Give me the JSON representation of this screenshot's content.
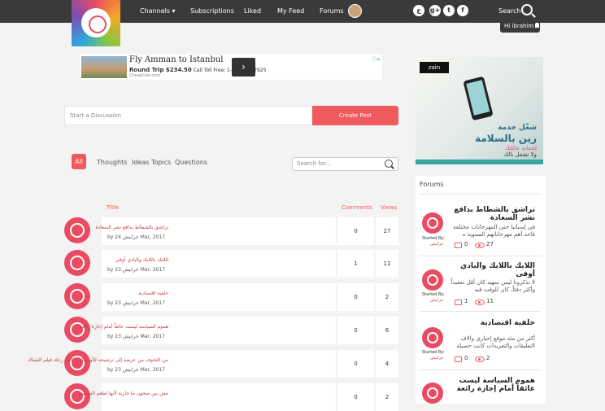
{
  "header": {
    "nav": [
      "Channels ▾",
      "Subscriptions",
      "Liked",
      "My Feed",
      "Forums"
    ],
    "social": [
      "ع",
      "g+",
      "t",
      "f"
    ],
    "search_label": "Search",
    "greeting": "Hi ibrahim"
  },
  "ad": {
    "title": "Fly Amman to Istanbul",
    "price_prefix": "Round Trip $234.50",
    "price_suffix": "Call Toll Free: 1-888-516-7925",
    "source": "CheapOair.com",
    "arrow": "›",
    "close": "ⓘ✕"
  },
  "composer": {
    "placeholder": "Start a Discussion",
    "create_label": "Create Post"
  },
  "filters": [
    "All",
    "Thoughts",
    "Ideas Topics",
    "Questions"
  ],
  "topic_search_placeholder": "Search for...",
  "table": {
    "headers": {
      "title": "Title",
      "comments": "Comments",
      "views": "Views"
    },
    "rows": [
      {
        "title": "تراشق بالشطاط بدافع نشر السعادة",
        "meta": "by خرابيش 24 Mar, 2017",
        "comments": "0",
        "views": "27"
      },
      {
        "title": "اللايك باللايك والبادي أوفى",
        "meta": "by خرابيش 23 Mar, 2017",
        "comments": "1",
        "views": "11"
      },
      {
        "title": "خلفية اقتصادية",
        "meta": "by خرابيش 23 Mar, 2017",
        "comments": "0",
        "views": "2"
      },
      {
        "title": "هموم السياسة ليست عائقاً أمام إجازة رائعة",
        "meta": "by خرابيش 23 Mar, 2017",
        "comments": "0",
        "views": "6"
      },
      {
        "title": "من التخوف من عرضه إلى ترشيحه للأوسكار.. كانت رحلة فيلم الشباك",
        "meta": "by خرابيش 23 Mar, 2017",
        "comments": "0",
        "views": "4"
      },
      {
        "title": "مش بين صحون ما جارية لأنها اطعم التحميب",
        "meta": "",
        "comments": "0",
        "views": "2"
      }
    ]
  },
  "banner": {
    "brand": "zain",
    "line1": "شغّل خدمة",
    "line2": "زين بالسلامة",
    "line3": "لحماية عائلتك",
    "line4": "ولا تشغل بالك"
  },
  "forums": {
    "heading": "Forums",
    "started_by": "Started By:",
    "items": [
      {
        "title": "تراشق بالشطاط بدافع نشر السعادة",
        "desc": "في إسبانيا حتى المهرجانات مختلفة فاحد أهم مهرجاناتهم السنوية ه",
        "user": "خرابيش",
        "comments": "0",
        "views": "27"
      },
      {
        "title": "اللايك باللايك والبادي أوفى",
        "desc": "لا تذكرونا ليس سهيد كان أقل تعقيداً وأكثر دفئاً، كان للوقت فيه",
        "user": "خرابيش",
        "comments": "1",
        "views": "11"
      },
      {
        "title": "خلفية اقتصادية",
        "desc": "أكثر من مئة موقع إخباري والاف التعليقات والتغريدات كانت حصيلة",
        "user": "خرابيش",
        "comments": "0",
        "views": "2"
      },
      {
        "title": "هموم السياسة ليست عائقاً أمام إجازة رائعة",
        "desc": "",
        "user": "",
        "comments": "",
        "views": ""
      }
    ]
  }
}
